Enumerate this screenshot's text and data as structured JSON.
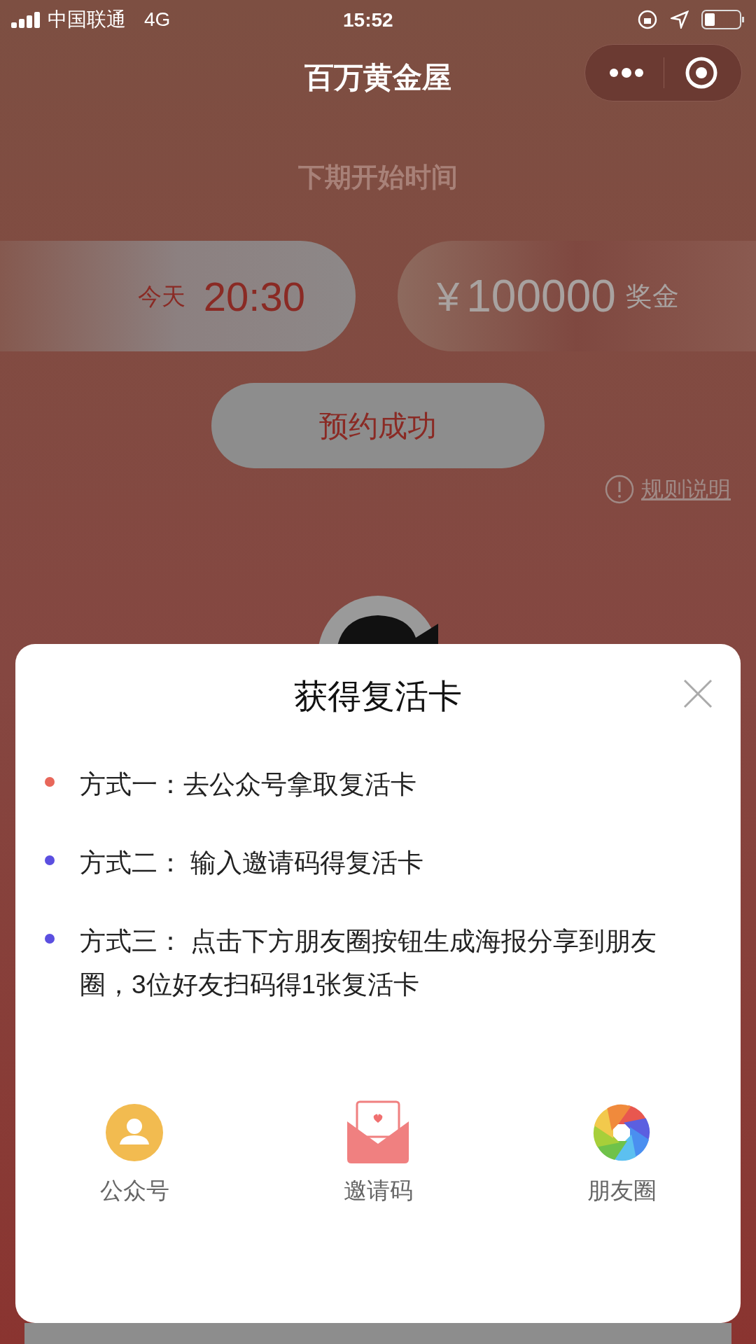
{
  "status_bar": {
    "carrier": "中国联通",
    "network": "4G",
    "time": "15:52"
  },
  "nav": {
    "title": "百万黄金屋"
  },
  "next_round": {
    "label": "下期开始时间",
    "day": "今天",
    "time": "20:30",
    "prize_currency": "¥",
    "prize_amount": "100000",
    "prize_unit": "奖金",
    "reserve_button": "预约成功",
    "rules_link": "规则说明"
  },
  "modal": {
    "title": "获得复活卡",
    "methods": [
      {
        "text": "方式一：去公众号拿取复活卡",
        "color": "#e8675a"
      },
      {
        "text": "方式二： 输入邀请码得复活卡",
        "color": "#5b4fe0"
      },
      {
        "text": "方式三： 点击下方朋友圈按钮生成海报分享到朋友圈，3位好友扫码得1张复活卡",
        "color": "#5b4fe0"
      }
    ],
    "shares": [
      {
        "kind": "account",
        "label": "公众号"
      },
      {
        "kind": "invite",
        "label": "邀请码"
      },
      {
        "kind": "moments",
        "label": "朋友圈"
      }
    ]
  }
}
